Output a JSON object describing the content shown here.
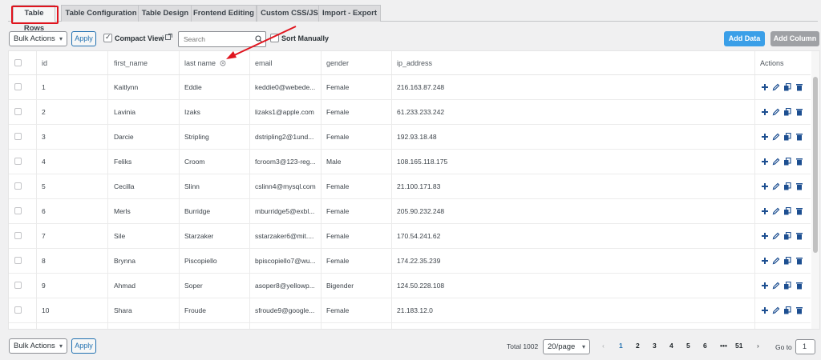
{
  "tabs": [
    {
      "label": "Table Rows",
      "active": true
    },
    {
      "label": "Table Configuration",
      "active": false
    },
    {
      "label": "Table Design",
      "active": false
    },
    {
      "label": "Frontend Editing",
      "active": false
    },
    {
      "label": "Custom CSS/JS",
      "active": false
    },
    {
      "label": "Import - Export",
      "active": false
    }
  ],
  "toolbar": {
    "bulk_actions": "Bulk Actions",
    "apply": "Apply",
    "compact_view": "Compact View",
    "search_placeholder": "Search",
    "sort_manually": "Sort Manually",
    "add_data": "Add Data",
    "add_column": "Add Column"
  },
  "colors": {
    "accent": "#2271b1",
    "add_data_bg": "#3a9fe8",
    "add_column_bg": "#9fa1a5",
    "highlight": "#e0141e"
  },
  "table": {
    "columns": [
      "id",
      "first_name",
      "last name",
      "email",
      "gender",
      "ip_address",
      "Actions"
    ],
    "rows": [
      [
        "1",
        "Kaitlynn",
        "Eddie",
        "keddie0@webede...",
        "Female",
        "216.163.87.248"
      ],
      [
        "2",
        "Lavinia",
        "Izaks",
        "lizaks1@apple.com",
        "Female",
        "61.233.233.242"
      ],
      [
        "3",
        "Darcie",
        "Stripling",
        "dstripling2@1und...",
        "Female",
        "192.93.18.48"
      ],
      [
        "4",
        "Feliks",
        "Croom",
        "fcroom3@123-reg...",
        "Male",
        "108.165.118.175"
      ],
      [
        "5",
        "Cecilla",
        "Slinn",
        "cslinn4@mysql.com",
        "Female",
        "21.100.171.83"
      ],
      [
        "6",
        "Merls",
        "Burridge",
        "mburridge5@exbl...",
        "Female",
        "205.90.232.248"
      ],
      [
        "7",
        "Sile",
        "Starzaker",
        "sstarzaker6@mit....",
        "Female",
        "170.54.241.62"
      ],
      [
        "8",
        "Brynna",
        "Piscopiello",
        "bpiscopiello7@wu...",
        "Female",
        "174.22.35.239"
      ],
      [
        "9",
        "Ahmad",
        "Soper",
        "asoper8@yellowp...",
        "Bigender",
        "124.50.228.108"
      ],
      [
        "10",
        "Shara",
        "Froude",
        "sfroude9@google...",
        "Female",
        "21.183.12.0"
      ]
    ]
  },
  "footer": {
    "bulk_actions": "Bulk Actions",
    "apply": "Apply",
    "total": "Total 1002",
    "page_size": "20/page",
    "pages": [
      "1",
      "2",
      "3",
      "4",
      "5",
      "6",
      "•••",
      "51"
    ],
    "current_page": "1",
    "goto_label": "Go to",
    "goto_value": "1"
  }
}
